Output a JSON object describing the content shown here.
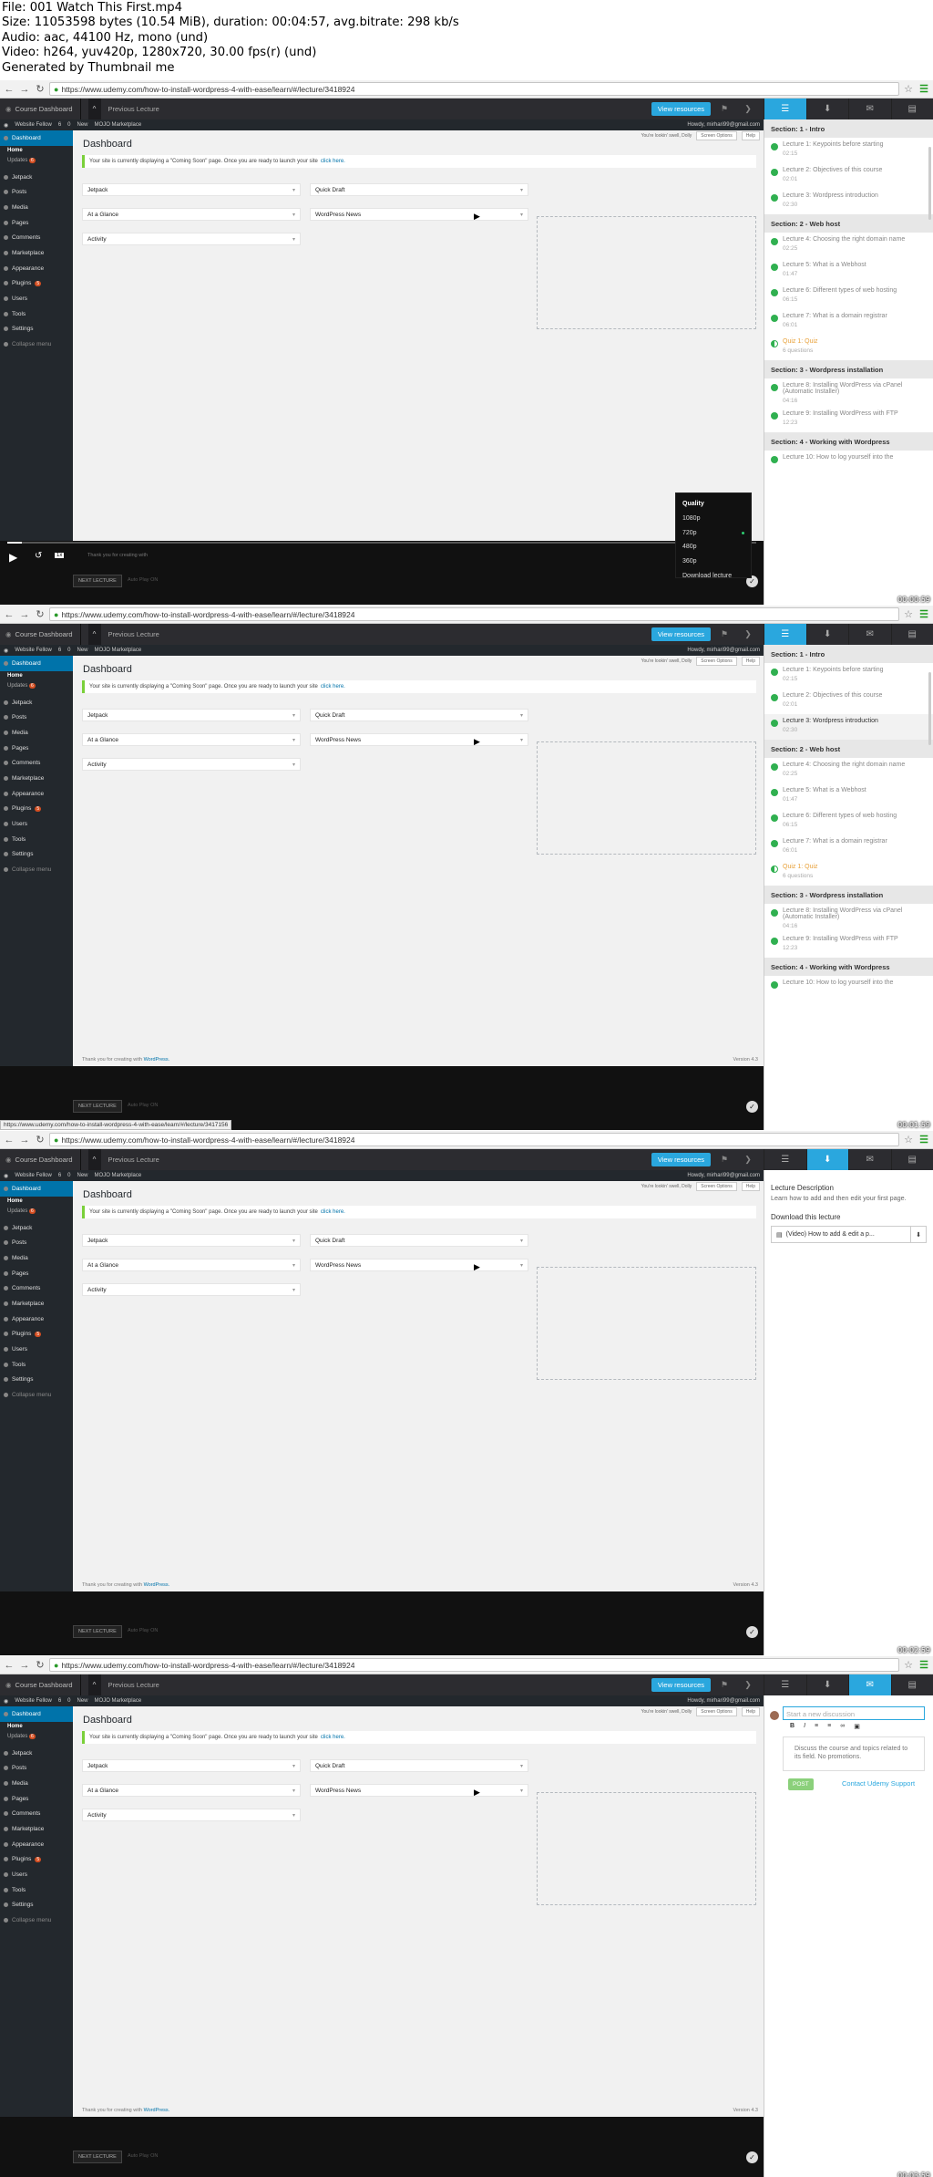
{
  "header": {
    "line1": "File: 001 Watch This First.mp4",
    "line2": "Size: 11053598 bytes (10.54 MiB), duration: 00:04:57, avg.bitrate: 298 kb/s",
    "line3": "Audio: aac, 44100 Hz, mono (und)",
    "line4": "Video: h264, yuv420p, 1280x720, 30.00 fps(r) (und)",
    "line5": "Generated by Thumbnail me"
  },
  "browser": {
    "url": "https://www.udemy.com/how-to-install-wordpress-4-with-ease/learn/#/lecture/3418924"
  },
  "course": {
    "home": "Course Dashboard",
    "prev": "Previous Lecture",
    "resources": "View resources"
  },
  "wp": {
    "site": "Website Fellow",
    "comments": "6",
    "plus": "0",
    "new": "New",
    "market": "MOJO Marketplace",
    "howdy": "Howdy, mirhari99@gmail.com",
    "dash_title": "Dashboard",
    "notice": "Your site is currently displaying a \"Coming Soon\" page. Once you are ready to launch your site",
    "click": "click here.",
    "youve": "You're lookin' swell, Dolly",
    "screen": "Screen Options",
    "help": "Help",
    "w1": "Jetpack",
    "w2": "At a Glance",
    "w3": "Activity",
    "w4": "Quick Draft",
    "w5": "WordPress News",
    "foot": "Thank you for creating with",
    "wpl": "WordPress.",
    "ver": "Version 4.3"
  },
  "menu": {
    "dash": "Dashboard",
    "home": "Home",
    "upd": "Updates",
    "updc": "6",
    "jet": "Jetpack",
    "posts": "Posts",
    "media": "Media",
    "pages": "Pages",
    "comm": "Comments",
    "mkt": "Marketplace",
    "app": "Appearance",
    "plug": "Plugins",
    "plugc": "5",
    "users": "Users",
    "tools": "Tools",
    "settings": "Settings",
    "coll": "Collapse menu"
  },
  "player": {
    "next": "NEXT LECTURE",
    "auto": "Auto Play ON",
    "speed": "1x",
    "made": "Thank you for creating with"
  },
  "quality": {
    "title": "Quality",
    "opts": [
      "1080p",
      "720p",
      "480p",
      "360p"
    ],
    "dl": "Download lecture"
  },
  "curr": {
    "s1": "Section: 1 - Intro",
    "l1": "Lecture 1: Keypoints before starting",
    "t1": "02:15",
    "l2": "Lecture 2: Objectives of this course",
    "t2": "02:01",
    "l3": "Lecture 3: Wordpress introduction",
    "t3": "02:30",
    "s2": "Section: 2 - Web host",
    "l4": "Lecture 4: Choosing the right domain name",
    "t4": "02:25",
    "l5": "Lecture 5: What is a Webhost",
    "t5": "01:47",
    "l6": "Lecture 6: Different types of web hosting",
    "t6": "06:15",
    "l7": "Lecture 7: What is a domain registrar",
    "t7": "06:01",
    "q": "Quiz 1:",
    "qt": "Quiz",
    "qn": "6 questions",
    "s3": "Section: 3 - Wordpress installation",
    "l8": "Lecture 8: Installing WordPress via cPanel (Automatic Installer)",
    "t8": "04:16",
    "l9": "Lecture 9: Installing WordPress with FTP",
    "t9": "12:23",
    "s4": "Section: 4 - Working with Wordpress",
    "l10": "Lecture 10: How to log yourself into the"
  },
  "dl": {
    "title": "Lecture Description",
    "desc": "Learn how to add and then edit your first page.",
    "dtitle": "Download this lecture",
    "file": "(Video) How to add & edit a p..."
  },
  "disc": {
    "ph": "Start a new discussion",
    "ta": "Discuss the course and topics related to its field. No promotions.",
    "post": "POST",
    "support": "Contact Udemy Support"
  },
  "status": {
    "url": "https://www.udemy.com/how-to-install-wordpress-4-with-ease/learn/#/lecture/3417156"
  },
  "stamps": [
    "00:00:59",
    "00:01:59",
    "00:02:59",
    "00:03:59"
  ]
}
